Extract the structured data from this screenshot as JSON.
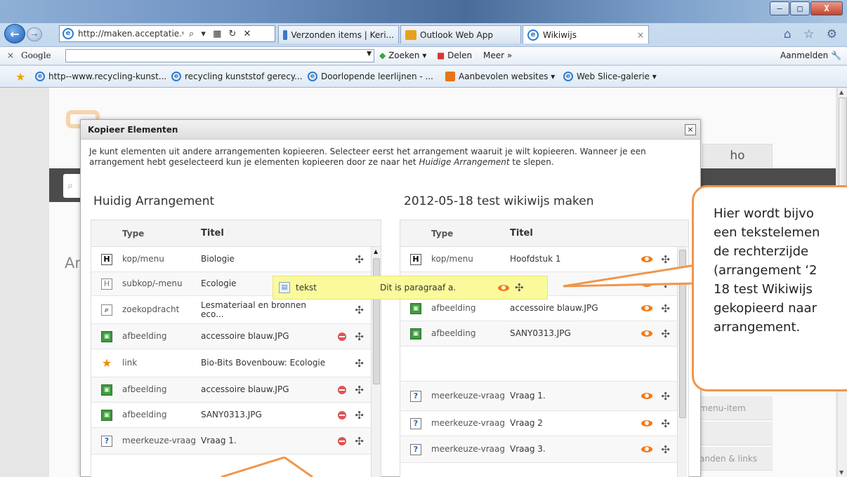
{
  "browser": {
    "address_url": "http://maken.acceptatie.wi...",
    "address_controls": "⌕ ▾ ▦ ↻ ✕",
    "tabs": [
      {
        "label": "Verzonden items | Keri..."
      },
      {
        "label": "Outlook Web App"
      },
      {
        "label": "Wikiwijs",
        "close": "×"
      }
    ],
    "window_buttons": {
      "minimize": "–",
      "maximize": "□",
      "close": "X"
    },
    "right_icons": "⌂ ☆ ⚙"
  },
  "googlebar": {
    "close": "×",
    "logo": "Google",
    "search_value": "",
    "zoeken": "Zoeken ▾",
    "delen": "Delen",
    "meer": "Meer »",
    "aanmelden": "Aanmelden"
  },
  "favorites": [
    {
      "label": "http--www.recycling-kunst..."
    },
    {
      "label": "recycling kunststof gerecy..."
    },
    {
      "label": "Doorlopende leerlijnen - ..."
    },
    {
      "label": "Aanbevolen websites ▾"
    },
    {
      "label": "Web Slice-galerie ▾"
    }
  ],
  "site": {
    "ho": "ho",
    "ar": "Ar",
    "side_items": [
      "menu-item",
      "",
      "anden & links"
    ]
  },
  "modal": {
    "title": "Kopieer Elementen",
    "close": "×",
    "desc_before": "Je kunt elementen uit andere arrangementen kopieeren. Selecteer eerst het arrangement waaruit je wilt kopieeren. Wanneer je een arrangement hebt geselecteerd kun je elementen kopieeren door ze naar het ",
    "desc_em": "Huidige Arrangement",
    "desc_after": " te slepen.",
    "left": {
      "title": "Huidig Arrangement",
      "col_type": "Type",
      "col_title": "Titel",
      "rows": [
        {
          "icon": "H",
          "type": "kop/menu",
          "title": "Biologie"
        },
        {
          "icon": "H",
          "type": "subkop/-menu",
          "title": "Ecologie"
        },
        {
          "icon": "⌕",
          "type": "zoekopdracht",
          "title": "Lesmateriaal en bronnen eco..."
        },
        {
          "icon": "▣",
          "type": "afbeelding",
          "title": "accessoire blauw.JPG"
        },
        {
          "icon": "★",
          "type": "link",
          "title": "Bio-Bits Bovenbouw: Ecologie"
        },
        {
          "icon": "▣",
          "type": "afbeelding",
          "title": "accessoire blauw.JPG"
        },
        {
          "icon": "▣",
          "type": "afbeelding",
          "title": "SANY0313.JPG"
        },
        {
          "icon": "?",
          "type": "meerkeuze-vraag",
          "title": "Vraag 1."
        }
      ]
    },
    "right": {
      "title": "2012-05-18 test wikiwijs maken",
      "col_type": "Type",
      "col_title": "Titel",
      "rows": [
        {
          "icon": "H",
          "type": "kop/menu",
          "title": "Hoofdstuk 1"
        },
        {
          "icon": "",
          "type": "",
          "title": "af a."
        },
        {
          "icon": "▣",
          "type": "afbeelding",
          "title": "accessoire blauw.JPG"
        },
        {
          "icon": "▣",
          "type": "afbeelding",
          "title": "SANY0313.JPG"
        },
        {
          "icon": "",
          "type": "",
          "title": ""
        },
        {
          "icon": "?",
          "type": "meerkeuze-vraag",
          "title": "Vraag 1."
        },
        {
          "icon": "?",
          "type": "meerkeuze-vraag",
          "title": "Vraag 2"
        },
        {
          "icon": "?",
          "type": "meerkeuze-vraag",
          "title": "Vraag 3."
        }
      ]
    },
    "dragged": {
      "icon": "▤",
      "type": "tekst",
      "title": "Dit is paragraaf a."
    }
  },
  "callout": {
    "lines": [
      "Hier wordt bijvo",
      "een tekstelemen",
      "de rechterzijde",
      "(arrangement ‘2",
      "18 test Wikiwijs",
      "gekopieerd naar",
      "arrangement."
    ]
  },
  "icons": {
    "move": "✣",
    "delete": "minus-circle",
    "view": "eye"
  },
  "colors": {
    "accent_orange": "#f0954a",
    "drag_highlight": "#fafa9c",
    "ie_blue": "#2a7bd1"
  }
}
